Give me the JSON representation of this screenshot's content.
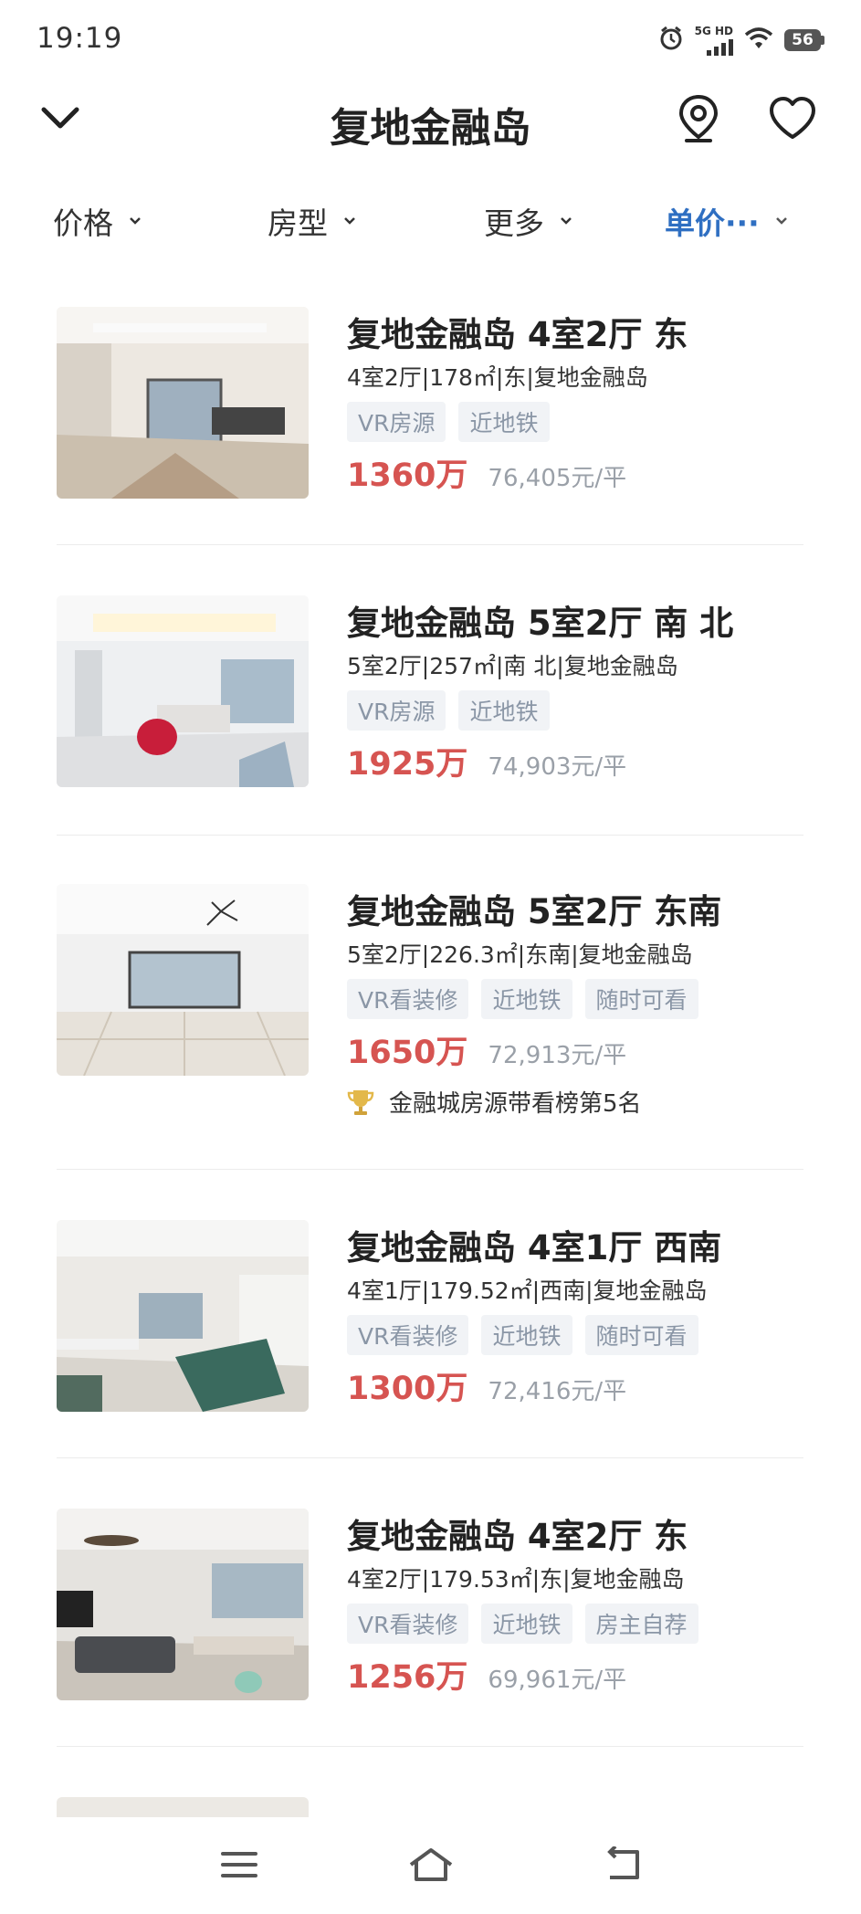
{
  "status_bar": {
    "time": "19:19",
    "network": "5G HD",
    "battery": "56",
    "icons": [
      "alarm-icon",
      "signal-icon",
      "wifi-icon",
      "battery-icon"
    ]
  },
  "header": {
    "title": "复地金融岛",
    "icons": [
      "chevron-down-icon",
      "map-pin-icon",
      "heart-icon"
    ]
  },
  "filters": [
    {
      "label": "价格",
      "active": false
    },
    {
      "label": "房型",
      "active": false
    },
    {
      "label": "更多",
      "active": false
    },
    {
      "label": "单价···",
      "active": true
    }
  ],
  "colors": {
    "price": "#d65451",
    "active_filter": "#2f6fc2",
    "tag_bg": "#f1f3f6",
    "tag_text": "#8a96a6"
  },
  "listings": [
    {
      "title": "复地金融岛 4室2厅 东",
      "info": "4室2厅|178㎡|东|复地金融岛",
      "tags": [
        "VR房源",
        "近地铁"
      ],
      "price": "1360万",
      "unit_price": "76,405元/平"
    },
    {
      "title": "复地金融岛 5室2厅 南 北",
      "info": "5室2厅|257㎡|南 北|复地金融岛",
      "tags": [
        "VR房源",
        "近地铁"
      ],
      "price": "1925万",
      "unit_price": "74,903元/平"
    },
    {
      "title": "复地金融岛 5室2厅 东南",
      "info": "5室2厅|226.3㎡|东南|复地金融岛",
      "tags": [
        "VR看装修",
        "近地铁",
        "随时可看"
      ],
      "price": "1650万",
      "unit_price": "72,913元/平",
      "rank_text": "金融城房源带看榜第5名"
    },
    {
      "title": "复地金融岛 4室1厅 西南",
      "info": "4室1厅|179.52㎡|西南|复地金融岛",
      "tags": [
        "VR看装修",
        "近地铁",
        "随时可看"
      ],
      "price": "1300万",
      "unit_price": "72,416元/平"
    },
    {
      "title": "复地金融岛 4室2厅 东",
      "info": "4室2厅|179.53㎡|东|复地金融岛",
      "tags": [
        "VR看装修",
        "近地铁",
        "房主自荐"
      ],
      "price": "1256万",
      "unit_price": "69,961元/平"
    }
  ],
  "nav_bar": {
    "icons": [
      "menu-icon",
      "home-icon",
      "back-icon"
    ]
  }
}
